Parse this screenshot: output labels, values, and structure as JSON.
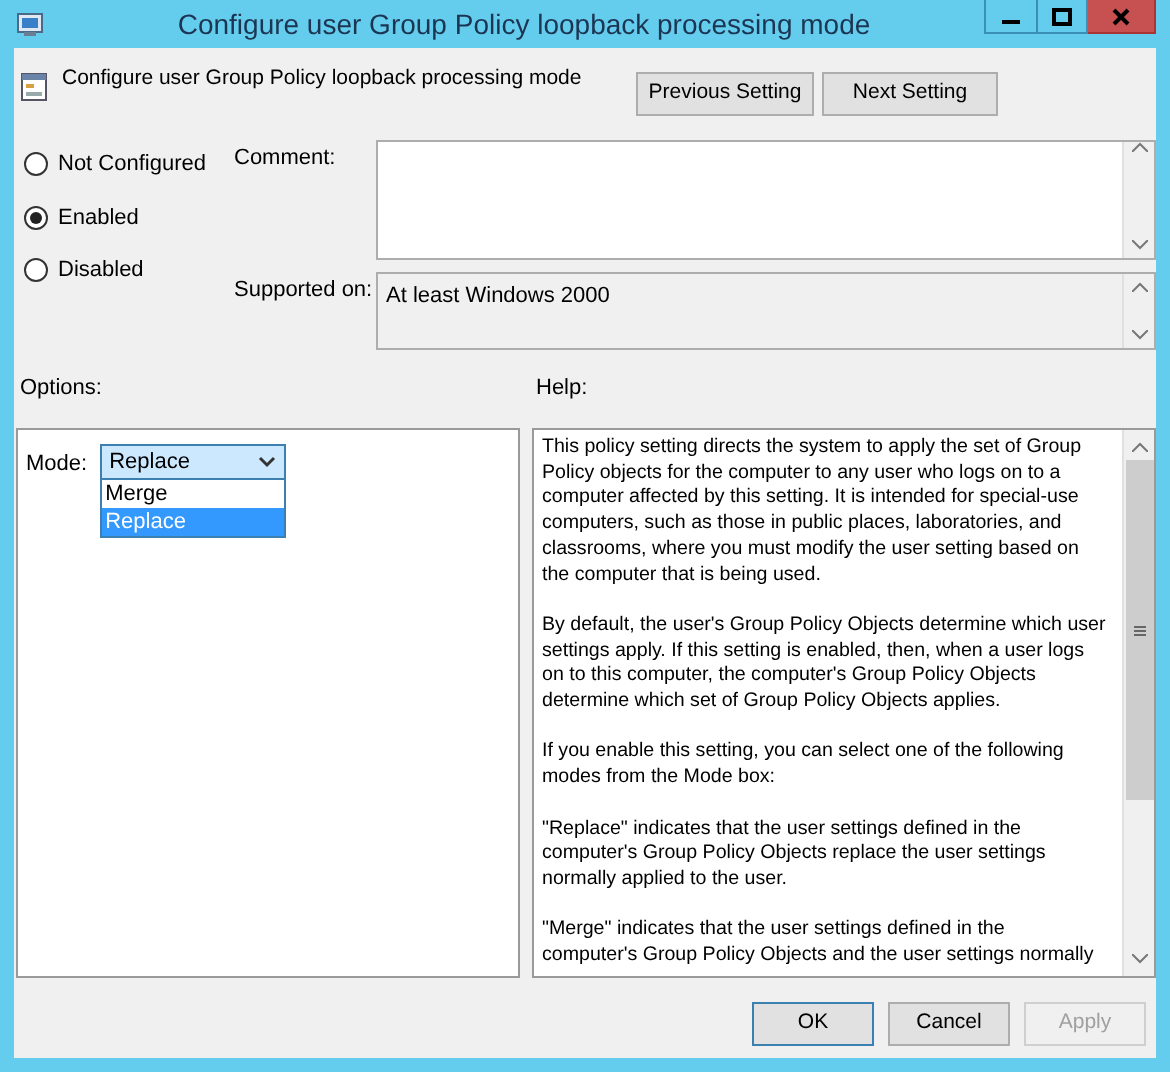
{
  "window": {
    "title": "Configure user Group Policy loopback processing mode"
  },
  "policy": {
    "title": "Configure user Group Policy loopback processing mode"
  },
  "nav_buttons": [
    "Previous Setting",
    "Next Setting"
  ],
  "state_options": [
    {
      "label": "Not Configured",
      "selected": false
    },
    {
      "label": "Enabled",
      "selected": true
    },
    {
      "label": "Disabled",
      "selected": false
    }
  ],
  "comment": {
    "label": "Comment:"
  },
  "supported_on": {
    "label": "Supported on:",
    "value": "At least Windows 2000"
  },
  "options": {
    "label": "Options:",
    "mode": {
      "label": "Mode:",
      "value": "Replace",
      "expanded": true,
      "items": [
        {
          "label": "Merge",
          "selected": false
        },
        {
          "label": "Replace",
          "selected": true
        }
      ]
    }
  },
  "help": {
    "label": "Help:",
    "paragraphs": [
      [
        "This policy setting directs the system to apply the set of Group",
        "Policy objects for the computer to any user who logs on to a",
        "computer affected by this setting. It is intended for special-use",
        "computers, such as those in public places, laboratories, and",
        "classrooms, where you must modify the user setting based on",
        "the computer that is being used."
      ],
      [
        "By default, the user's Group Policy Objects determine which user",
        "settings apply. If this setting is enabled, then, when a user logs",
        "on to this computer, the computer's Group Policy Objects",
        "determine which set of Group Policy Objects applies."
      ],
      [
        "If you enable this setting, you can select one of the following",
        "modes from the Mode box:"
      ],
      [
        "\"Replace\" indicates that the user settings defined in the",
        "computer's Group Policy Objects replace the user settings",
        "normally applied to the user."
      ],
      [
        "\"Merge\" indicates that the user settings defined in the",
        "computer's Group Policy Objects and the user settings normally"
      ]
    ]
  },
  "buttons": [
    {
      "label": "OK",
      "disabled": false
    },
    {
      "label": "Cancel",
      "disabled": false
    },
    {
      "label": "Apply",
      "disabled": true
    }
  ]
}
